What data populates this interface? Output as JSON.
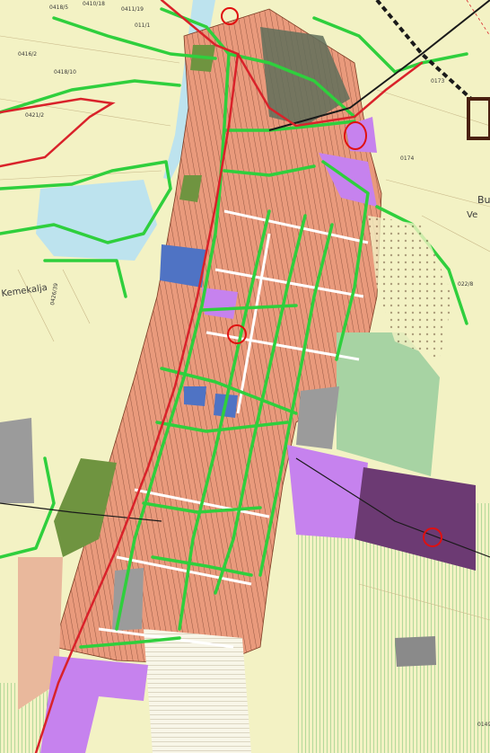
{
  "map": {
    "labels": {
      "kemekalja": "Kemekalja",
      "bu": "Bu",
      "cad_1": "0418/5",
      "cad_2": "0418/10",
      "cad_3": "0421/2",
      "cad_4": "0416/2",
      "cad_5": "0174",
      "cad_6": "0173",
      "cad_7": "0410/18",
      "cad_8": "0411/19",
      "cad_9": "0426/39",
      "cad_10": "011/1",
      "cad_11": "022/8",
      "cad_12": "0149",
      "cad_13": "Ve"
    },
    "legend_colors": {
      "residential": "#e99a7c",
      "residential_dark": "#c97a5f",
      "public": "#c682ee",
      "public_dark": "#6c3a73",
      "green_area": "#a7d3a3",
      "water": "#bde3ee",
      "industrial": "#9b9b9b",
      "forest": "#6f9440",
      "church": "#4f73c4",
      "roads": "#2fcf3d",
      "highway": "#d9222a",
      "railway": "#1a1a1a"
    },
    "markers": [
      {
        "name": "marker-north"
      },
      {
        "name": "marker-ne"
      },
      {
        "name": "marker-center"
      },
      {
        "name": "marker-se"
      }
    ]
  }
}
